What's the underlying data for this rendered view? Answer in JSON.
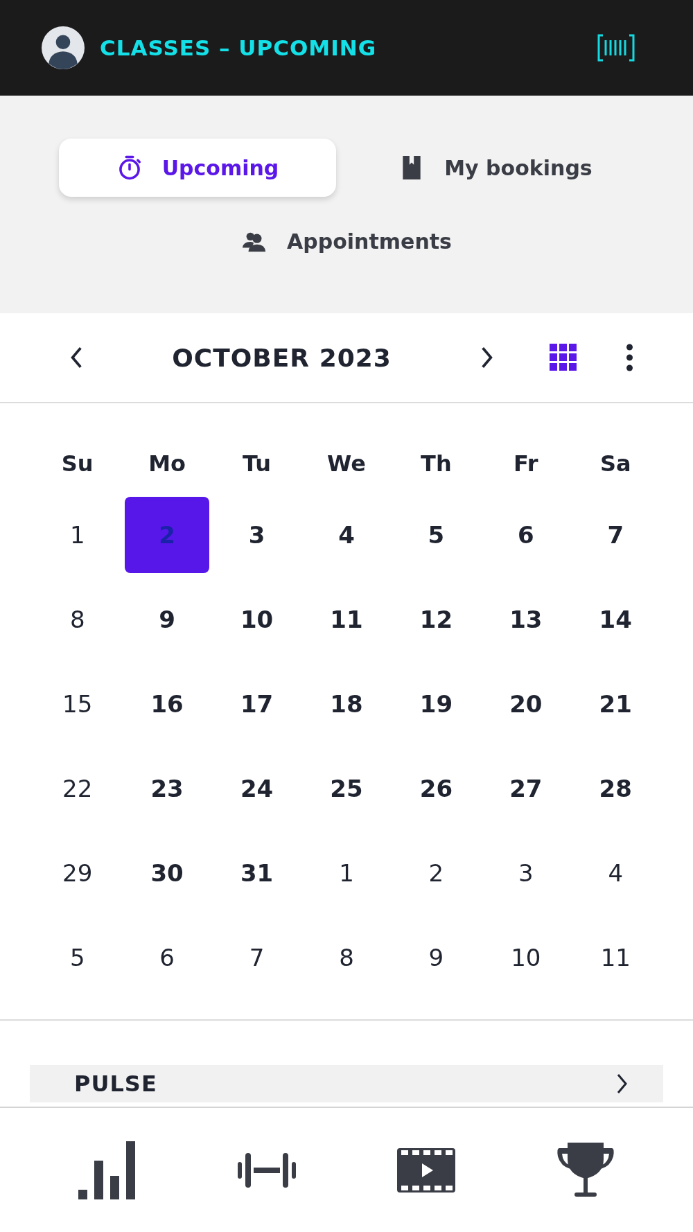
{
  "header": {
    "title": "CLASSES – UPCOMING"
  },
  "tabs": [
    {
      "label": "Upcoming",
      "selected": true
    },
    {
      "label": "My bookings",
      "selected": false
    },
    {
      "label": "Appointments",
      "selected": false
    }
  ],
  "calendar": {
    "month": "OCTOBER 2023",
    "weekdays": [
      "Su",
      "Mo",
      "Tu",
      "We",
      "Th",
      "Fr",
      "Sa"
    ],
    "days": [
      {
        "label": "1",
        "has_classes": false,
        "selected": false
      },
      {
        "label": "2",
        "has_classes": true,
        "selected": true
      },
      {
        "label": "3",
        "has_classes": true,
        "selected": false
      },
      {
        "label": "4",
        "has_classes": true,
        "selected": false
      },
      {
        "label": "5",
        "has_classes": true,
        "selected": false
      },
      {
        "label": "6",
        "has_classes": true,
        "selected": false
      },
      {
        "label": "7",
        "has_classes": true,
        "selected": false
      },
      {
        "label": "8",
        "has_classes": false,
        "selected": false
      },
      {
        "label": "9",
        "has_classes": true,
        "selected": false
      },
      {
        "label": "10",
        "has_classes": true,
        "selected": false
      },
      {
        "label": "11",
        "has_classes": true,
        "selected": false
      },
      {
        "label": "12",
        "has_classes": true,
        "selected": false
      },
      {
        "label": "13",
        "has_classes": true,
        "selected": false
      },
      {
        "label": "14",
        "has_classes": true,
        "selected": false
      },
      {
        "label": "15",
        "has_classes": false,
        "selected": false
      },
      {
        "label": "16",
        "has_classes": true,
        "selected": false
      },
      {
        "label": "17",
        "has_classes": true,
        "selected": false
      },
      {
        "label": "18",
        "has_classes": true,
        "selected": false
      },
      {
        "label": "19",
        "has_classes": true,
        "selected": false
      },
      {
        "label": "20",
        "has_classes": true,
        "selected": false
      },
      {
        "label": "21",
        "has_classes": true,
        "selected": false
      },
      {
        "label": "22",
        "has_classes": false,
        "selected": false
      },
      {
        "label": "23",
        "has_classes": true,
        "selected": false
      },
      {
        "label": "24",
        "has_classes": true,
        "selected": false
      },
      {
        "label": "25",
        "has_classes": true,
        "selected": false
      },
      {
        "label": "26",
        "has_classes": true,
        "selected": false
      },
      {
        "label": "27",
        "has_classes": true,
        "selected": false
      },
      {
        "label": "28",
        "has_classes": true,
        "selected": false
      },
      {
        "label": "29",
        "has_classes": false,
        "selected": false
      },
      {
        "label": "30",
        "has_classes": true,
        "selected": false
      },
      {
        "label": "31",
        "has_classes": true,
        "selected": false
      },
      {
        "label": "1",
        "has_classes": false,
        "selected": false
      },
      {
        "label": "2",
        "has_classes": false,
        "selected": false
      },
      {
        "label": "3",
        "has_classes": false,
        "selected": false
      },
      {
        "label": "4",
        "has_classes": false,
        "selected": false
      },
      {
        "label": "5",
        "has_classes": false,
        "selected": false
      },
      {
        "label": "6",
        "has_classes": false,
        "selected": false
      },
      {
        "label": "7",
        "has_classes": false,
        "selected": false
      },
      {
        "label": "8",
        "has_classes": false,
        "selected": false
      },
      {
        "label": "9",
        "has_classes": false,
        "selected": false
      },
      {
        "label": "10",
        "has_classes": false,
        "selected": false
      },
      {
        "label": "11",
        "has_classes": false,
        "selected": false
      }
    ]
  },
  "class_card": {
    "title": "PULSE"
  }
}
